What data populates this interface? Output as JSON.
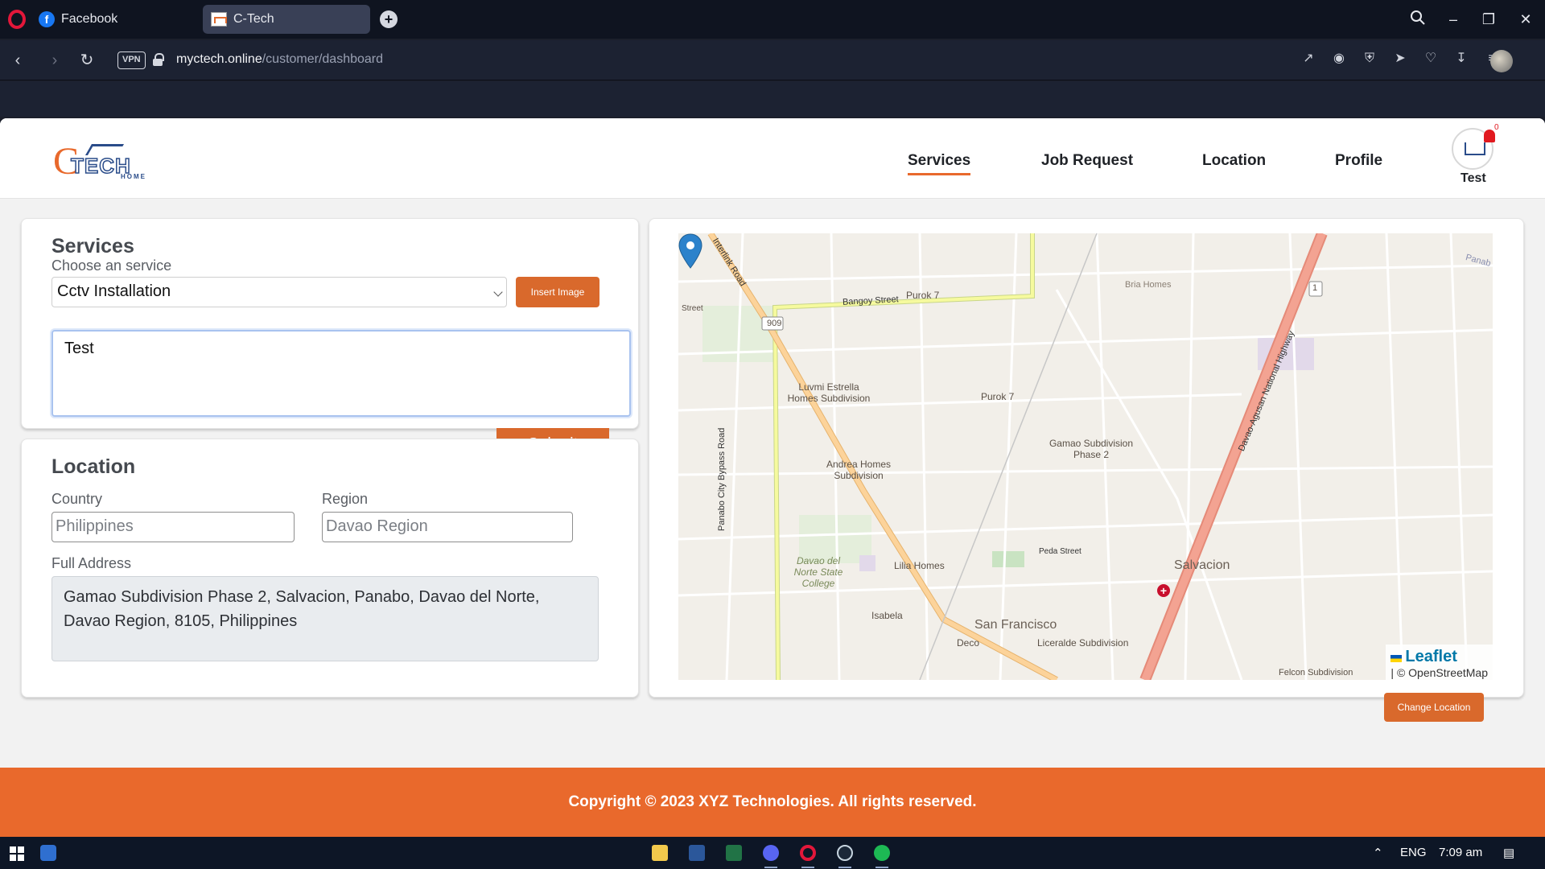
{
  "browser": {
    "tabs": [
      {
        "label": "Facebook"
      },
      {
        "label": "C-Tech"
      }
    ],
    "vpn_label": "VPN",
    "url_domain": "myctech.online",
    "url_path": "/customer/dashboard",
    "icons": [
      "search-icon",
      "minimize-icon",
      "restore-icon",
      "close-icon",
      "back-icon",
      "forward-icon",
      "reload-icon",
      "share-icon",
      "camera-icon",
      "shield-icon",
      "send-icon",
      "heart-icon",
      "download-icon",
      "menu-icon"
    ]
  },
  "header": {
    "logo_text": "C TECH",
    "logo_sub": "HOME",
    "nav": [
      {
        "label": "Services",
        "active": true
      },
      {
        "label": "Job Request",
        "active": false
      },
      {
        "label": "Location",
        "active": false
      },
      {
        "label": "Profile",
        "active": false
      }
    ],
    "notification_count": "0",
    "user_name": "Test"
  },
  "services": {
    "title": "Services",
    "choose_label": "Choose an service",
    "selected_service": "Cctv Installation",
    "insert_image_label": "Insert Image",
    "description": "Test",
    "submit_label": "Submit"
  },
  "location": {
    "title": "Location",
    "country_label": "Country",
    "country_value": "Philippines",
    "region_label": "Region",
    "region_value": "Davao Region",
    "full_address_label": "Full Address",
    "full_address_value": "Gamao Subdivision Phase 2, Salvacion, Panabo, Davao del Norte, Davao Region, 8105, Philippines"
  },
  "map": {
    "labels": {
      "bangoy": "Bangoy Street",
      "purok7a": "Purok 7",
      "purok7b": "Purok 7",
      "bria": "Bria Homes",
      "luvmi": "Luvmi Estrella Homes Subdivision",
      "andrea": "Andrea Homes Subdivision",
      "gamao": "Gamao Subdivision Phase 2",
      "peda": "Peda Street",
      "salvacion": "Salvacion",
      "lilia": "Lilia Homes",
      "davao_college": "Davao del Norte State College",
      "isabela": "Isabela",
      "sanfrancisco": "San Francisco",
      "deco": "Deco",
      "liceralde": "Liceralde Subdivision",
      "felcon": "Felcon Subdivision",
      "bypass": "Panabo City Bypass Road",
      "highway": "Davao-Agusan National Highway",
      "interlink": "Interlink Road",
      "street_left": "Street",
      "route909": "909",
      "route1": "1",
      "panab": "Panab"
    },
    "attribution_leaflet": "Leaflet",
    "attribution_osm": "| © OpenStreetMap",
    "change_location_label": "Change Location"
  },
  "footer": {
    "text": "Copyright © 2023 XYZ Technologies. All rights reserved."
  },
  "taskbar": {
    "language": "ENG",
    "time": "7:09 am",
    "apps": [
      "file-explorer-icon",
      "word-icon",
      "excel-icon",
      "discord-icon",
      "opera-icon",
      "steam-icon",
      "spotify-icon"
    ]
  }
}
